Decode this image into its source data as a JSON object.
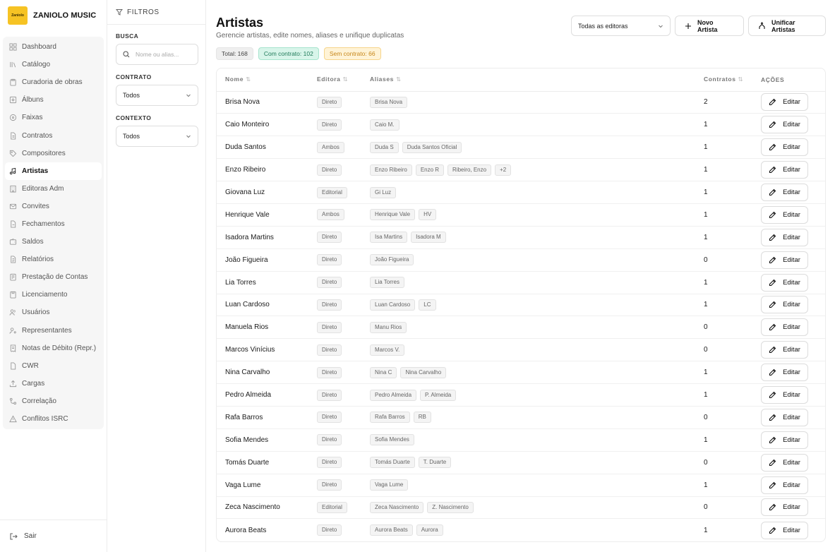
{
  "brand": {
    "logo_text": "Zaniolo",
    "name": "ZANIOLO MUSIC"
  },
  "nav": [
    {
      "label": "Dashboard",
      "icon": "grid-icon"
    },
    {
      "label": "Catálogo",
      "icon": "library-icon"
    },
    {
      "label": "Curadoria de obras",
      "icon": "clipboard-icon"
    },
    {
      "label": "Álbuns",
      "icon": "album-icon"
    },
    {
      "label": "Faixas",
      "icon": "disc-icon"
    },
    {
      "label": "Contratos",
      "icon": "file-icon"
    },
    {
      "label": "Compositores",
      "icon": "tag-icon"
    },
    {
      "label": "Artistas",
      "icon": "music-note-icon",
      "active": true
    },
    {
      "label": "Editoras Adm",
      "icon": "building-icon"
    },
    {
      "label": "Convites",
      "icon": "mail-icon"
    },
    {
      "label": "Fechamentos",
      "icon": "document-icon"
    },
    {
      "label": "Saldos",
      "icon": "wallet-icon"
    },
    {
      "label": "Relatórios",
      "icon": "report-icon"
    },
    {
      "label": "Prestação de Contas",
      "icon": "ledger-icon"
    },
    {
      "label": "Licenciamento",
      "icon": "license-icon"
    },
    {
      "label": "Usuários",
      "icon": "users-icon"
    },
    {
      "label": "Representantes",
      "icon": "user-key-icon"
    },
    {
      "label": "Notas de Débito (Repr.)",
      "icon": "receipt-icon"
    },
    {
      "label": "CWR",
      "icon": "cwr-icon"
    },
    {
      "label": "Cargas",
      "icon": "upload-icon"
    },
    {
      "label": "Correlação",
      "icon": "link-icon"
    },
    {
      "label": "Conflitos ISRC",
      "icon": "warning-icon"
    }
  ],
  "footer": {
    "logout_label": "Sair"
  },
  "filters": {
    "title": "FILTROS",
    "search_label": "BUSCA",
    "search_placeholder": "Nome ou alias...",
    "contract_label": "CONTRATO",
    "contract_value": "Todos",
    "context_label": "CONTEXTO",
    "context_value": "Todos"
  },
  "header": {
    "title": "Artistas",
    "subtitle": "Gerencie artistas, edite nomes, aliases e unifique duplicatas",
    "stats": {
      "total": "Total: 168",
      "with_contract": "Com contrato: 102",
      "without_contract": "Sem contrato: 66"
    },
    "editor_select": "Todas as editoras",
    "new_button": "Novo Artista",
    "merge_button": "Unificar Artistas"
  },
  "table": {
    "columns": {
      "name": "Nome",
      "editor": "Editora",
      "aliases": "Aliases",
      "contracts": "Contratos",
      "actions": "AÇÕES"
    },
    "edit_label": "Editar",
    "rows": [
      {
        "name": "Brisa Nova",
        "editor": "Direto",
        "aliases": [
          "Brisa Nova"
        ],
        "contracts": "2"
      },
      {
        "name": "Caio Monteiro",
        "editor": "Direto",
        "aliases": [
          "Caio M."
        ],
        "contracts": "1"
      },
      {
        "name": "Duda Santos",
        "editor": "Ambos",
        "aliases": [
          "Duda S",
          "Duda Santos Oficial"
        ],
        "contracts": "1"
      },
      {
        "name": "Enzo Ribeiro",
        "editor": "Direto",
        "aliases": [
          "Enzo Ribeiro",
          "Enzo R",
          "Ribeiro, Enzo",
          "+2"
        ],
        "contracts": "1"
      },
      {
        "name": "Giovana Luz",
        "editor": "Editorial",
        "aliases": [
          "Gi Luz"
        ],
        "contracts": "1"
      },
      {
        "name": "Henrique Vale",
        "editor": "Ambos",
        "aliases": [
          "Henrique Vale",
          "HV"
        ],
        "contracts": "1"
      },
      {
        "name": "Isadora Martins",
        "editor": "Direto",
        "aliases": [
          "Isa Martins",
          "Isadora M"
        ],
        "contracts": "1"
      },
      {
        "name": "João Figueira",
        "editor": "Direto",
        "aliases": [
          "João Figueira"
        ],
        "contracts": "0"
      },
      {
        "name": "Lia Torres",
        "editor": "Direto",
        "aliases": [
          "Lia Torres"
        ],
        "contracts": "1"
      },
      {
        "name": "Luan Cardoso",
        "editor": "Direto",
        "aliases": [
          "Luan Cardoso",
          "LC"
        ],
        "contracts": "1"
      },
      {
        "name": "Manuela Rios",
        "editor": "Direto",
        "aliases": [
          "Manu Rios"
        ],
        "contracts": "0"
      },
      {
        "name": "Marcos Vinícius",
        "editor": "Direto",
        "aliases": [
          "Marcos V."
        ],
        "contracts": "0"
      },
      {
        "name": "Nina Carvalho",
        "editor": "Direto",
        "aliases": [
          "Nina C",
          "Nina Carvalho"
        ],
        "contracts": "1"
      },
      {
        "name": "Pedro Almeida",
        "editor": "Direto",
        "aliases": [
          "Pedro Almeida",
          "P. Almeida"
        ],
        "contracts": "1"
      },
      {
        "name": "Rafa Barros",
        "editor": "Direto",
        "aliases": [
          "Rafa Barros",
          "RB"
        ],
        "contracts": "0"
      },
      {
        "name": "Sofia Mendes",
        "editor": "Direto",
        "aliases": [
          "Sofia Mendes"
        ],
        "contracts": "1"
      },
      {
        "name": "Tomás Duarte",
        "editor": "Direto",
        "aliases": [
          "Tomás Duarte",
          "T. Duarte"
        ],
        "contracts": "0"
      },
      {
        "name": "Vaga Lume",
        "editor": "Direto",
        "aliases": [
          "Vaga Lume"
        ],
        "contracts": "1"
      },
      {
        "name": "Zeca Nascimento",
        "editor": "Editorial",
        "aliases": [
          "Zeca Nascimento",
          "Z. Nascimento"
        ],
        "contracts": "0"
      },
      {
        "name": "Aurora Beats",
        "editor": "Direto",
        "aliases": [
          "Aurora Beats",
          "Aurora"
        ],
        "contracts": "1"
      }
    ]
  },
  "colors": {
    "logo": "#f6c324",
    "with_contract": "#1f7a59",
    "without_contract": "#c6861a"
  }
}
